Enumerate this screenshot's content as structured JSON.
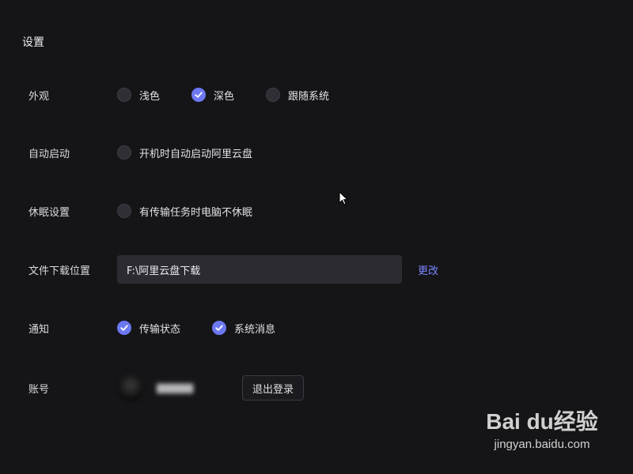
{
  "page": {
    "title": "设置"
  },
  "appearance": {
    "label": "外观",
    "options": [
      {
        "label": "浅色",
        "checked": false
      },
      {
        "label": "深色",
        "checked": true
      },
      {
        "label": "跟随系统",
        "checked": false
      }
    ]
  },
  "autostart": {
    "label": "自动启动",
    "option": "开机时自动启动阿里云盘",
    "checked": false
  },
  "sleep": {
    "label": "休眠设置",
    "option": "有传输任务时电脑不休眠",
    "checked": false
  },
  "download": {
    "label": "文件下载位置",
    "path": "F:\\阿里云盘下载",
    "change": "更改"
  },
  "notify": {
    "label": "通知",
    "options": [
      {
        "label": "传输状态",
        "checked": true
      },
      {
        "label": "系统消息",
        "checked": true
      }
    ]
  },
  "account": {
    "label": "账号",
    "logout": "退出登录"
  },
  "watermark": {
    "logo": "Bai du经验",
    "url": "jingyan.baidu.com"
  },
  "colors": {
    "accent": "#6c78f2",
    "link": "#7a86ff",
    "background": "#151518"
  }
}
